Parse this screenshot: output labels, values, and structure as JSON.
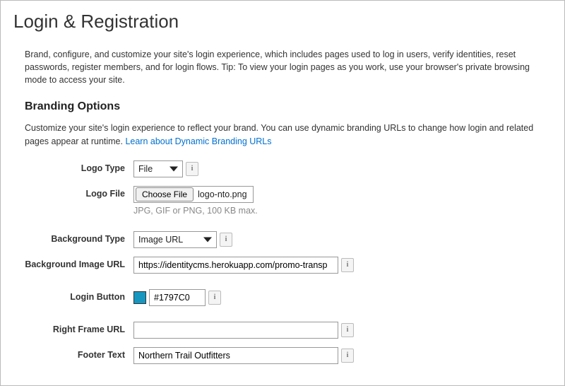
{
  "page": {
    "title": "Login & Registration",
    "description": "Brand, configure, and customize your site's login experience, which includes pages used to log in users, verify identities, reset passwords, register members, and for login flows. Tip: To view your login pages as you work, use your browser's private browsing mode to access your site."
  },
  "branding": {
    "title": "Branding Options",
    "description_before_link": "Customize your site's login experience to reflect your brand. You can use dynamic branding URLs to change how login and related pages appear at runtime. ",
    "link_text": "Learn about Dynamic Branding URLs"
  },
  "fields": {
    "logo_type": {
      "label": "Logo Type",
      "value": "File"
    },
    "logo_file": {
      "label": "Logo File",
      "button": "Choose File",
      "filename": "logo-nto.png",
      "hint": "JPG, GIF or PNG, 100 KB max."
    },
    "background_type": {
      "label": "Background Type",
      "value": "Image URL"
    },
    "background_image_url": {
      "label": "Background Image URL",
      "value": "https://identitycms.herokuapp.com/promo-transp"
    },
    "login_button": {
      "label": "Login Button",
      "color": "#1797C0"
    },
    "right_frame_url": {
      "label": "Right Frame URL",
      "value": ""
    },
    "footer_text": {
      "label": "Footer Text",
      "value": "Northern Trail Outfitters"
    }
  },
  "info_glyph": "i"
}
